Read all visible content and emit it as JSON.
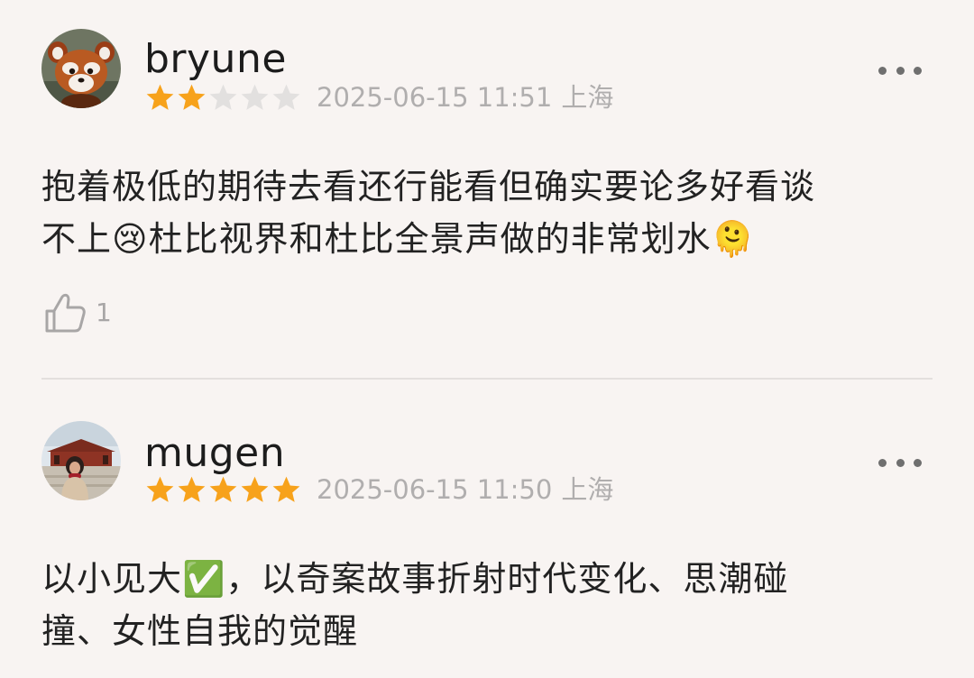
{
  "reviews": [
    {
      "username": "bryune",
      "rating": 2,
      "max_rating": 5,
      "date": "2025-06-15 11:51",
      "location": "上海",
      "content": "抱着极低的期待去看还行能看但确实要论多好看谈\n不上😢杜比视界和杜比全景声做的非常划水🫠",
      "likes": "1",
      "avatar_icon": "red-panda-avatar"
    },
    {
      "username": "mugen",
      "rating": 5,
      "max_rating": 5,
      "date": "2025-06-15 11:50",
      "location": "上海",
      "content": "以小见大✅，以奇案故事折射时代变化、思潮碰\n撞、女性自我的觉醒",
      "avatar_icon": "person-photo-avatar"
    }
  ],
  "colors": {
    "star_filled": "#f7a21b",
    "star_empty": "#e2e0df",
    "meta_text": "#b0aeae",
    "background": "#f8f4f2"
  }
}
